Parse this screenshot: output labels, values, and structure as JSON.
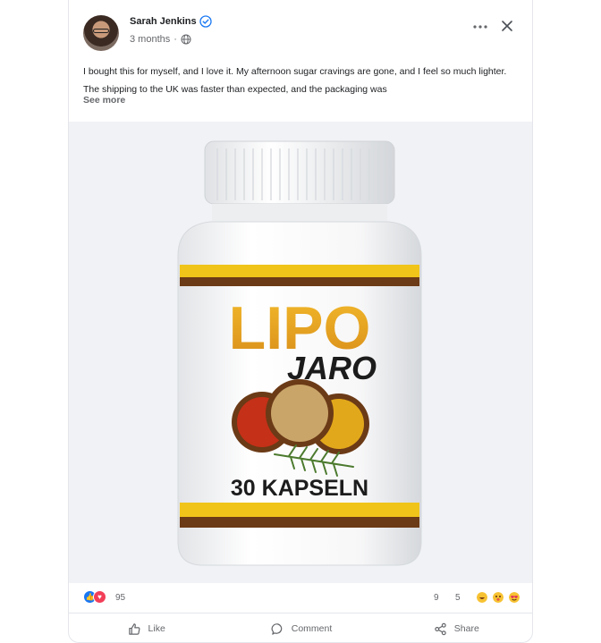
{
  "post": {
    "author": "Sarah Jenkins",
    "time": "3 months",
    "separator": "·",
    "text": "I bought this for myself, and I love it. My afternoon sugar cravings are gone, and I feel so much lighter. The shipping to the UK was faster than expected, and the packaging was",
    "see_more": "See more"
  },
  "product_image": {
    "brand_top": "LIPO",
    "brand_bottom": "JARO",
    "capsules": "30 KAPSELN"
  },
  "engagement": {
    "reaction_count": "95",
    "comment_count": "9",
    "share_count": "5"
  },
  "actions": {
    "like": "Like",
    "comment": "Comment",
    "share": "Share"
  },
  "colors": {
    "accent_blue": "#1877f2",
    "love_red": "#f33e58",
    "label_yellow": "#f0c419",
    "label_brown": "#6b3a16"
  },
  "icons": [
    "verified-icon",
    "globe-icon",
    "more-icon",
    "close-icon",
    "like-icon",
    "comment-icon",
    "share-icon"
  ]
}
